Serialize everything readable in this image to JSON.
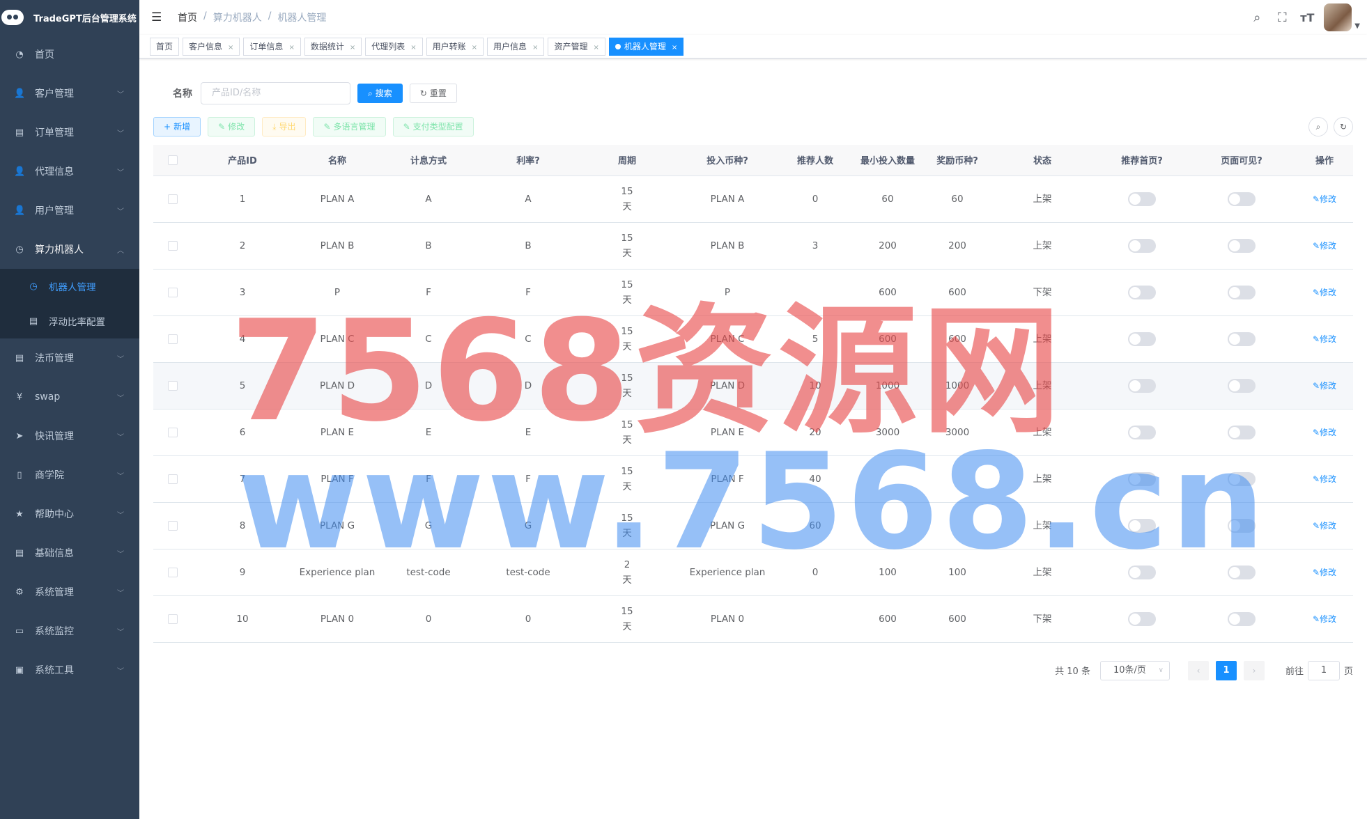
{
  "app": {
    "title": "TradeGPT后台管理系统"
  },
  "sidebar": {
    "items": [
      {
        "label": "首页",
        "icon": "dashboard-icon"
      },
      {
        "label": "客户管理",
        "icon": "user-icon"
      },
      {
        "label": "订单管理",
        "icon": "document-icon"
      },
      {
        "label": "代理信息",
        "icon": "user-icon"
      },
      {
        "label": "用户管理",
        "icon": "user-icon"
      },
      {
        "label": "算力机器人",
        "icon": "clock-icon"
      },
      {
        "label": "法币管理",
        "icon": "document-icon"
      },
      {
        "label": "swap",
        "icon": "yen-icon"
      },
      {
        "label": "快讯管理",
        "icon": "send-icon"
      },
      {
        "label": "商学院",
        "icon": "book-icon"
      },
      {
        "label": "帮助中心",
        "icon": "star-icon"
      },
      {
        "label": "基础信息",
        "icon": "document-icon"
      },
      {
        "label": "系统管理",
        "icon": "gear-icon"
      },
      {
        "label": "系统监控",
        "icon": "monitor-icon"
      },
      {
        "label": "系统工具",
        "icon": "toolbox-icon"
      }
    ],
    "sub": [
      {
        "label": "机器人管理",
        "icon": "clock-icon"
      },
      {
        "label": "浮动比率配置",
        "icon": "document-icon"
      }
    ]
  },
  "breadcrumb": [
    "首页",
    "/",
    "算力机器人",
    "/",
    "机器人管理"
  ],
  "tabs": [
    "首页",
    "客户信息",
    "订单信息",
    "数据统计",
    "代理列表",
    "用户转账",
    "用户信息",
    "资产管理",
    "机器人管理"
  ],
  "search": {
    "label": "名称",
    "placeholder": "产品ID/名称",
    "search_btn": "搜索",
    "reset_btn": "重置"
  },
  "toolbar": {
    "add": "新增",
    "edit": "修改",
    "export": "导出",
    "i18n": "多语言管理",
    "pay": "支付类型配置"
  },
  "table": {
    "headers": [
      "产品ID",
      "名称",
      "计息方式",
      "利率?",
      "周期",
      "投入币种?",
      "推荐人数",
      "最小投入数量",
      "奖励币种?",
      "状态",
      "推荐首页?",
      "页面可见?",
      "操作"
    ],
    "edit_label": "修改",
    "rows": [
      {
        "id": "1",
        "name": "PLAN A",
        "interest": "A",
        "rate": "A",
        "period": "15",
        "unit": "天",
        "coin": "PLAN A",
        "refs": "0",
        "min": "60",
        "reward": "60",
        "status": "上架",
        "recommend": false,
        "visible": false
      },
      {
        "id": "2",
        "name": "PLAN B",
        "interest": "B",
        "rate": "B",
        "period": "15",
        "unit": "天",
        "coin": "PLAN B",
        "refs": "3",
        "min": "200",
        "reward": "200",
        "status": "上架",
        "recommend": false,
        "visible": false
      },
      {
        "id": "3",
        "name": "P",
        "interest": "F",
        "rate": "F",
        "period": "15",
        "unit": "天",
        "coin": "P",
        "refs": "",
        "min": "600",
        "reward": "600",
        "status": "下架",
        "recommend": false,
        "visible": false
      },
      {
        "id": "4",
        "name": "PLAN C",
        "interest": "C",
        "rate": "C",
        "period": "15",
        "unit": "天",
        "coin": "PLAN C",
        "refs": "5",
        "min": "600",
        "reward": "600",
        "status": "上架",
        "recommend": false,
        "visible": false
      },
      {
        "id": "5",
        "name": "PLAN D",
        "interest": "D",
        "rate": "D",
        "period": "15",
        "unit": "天",
        "coin": "PLAN D",
        "refs": "10",
        "min": "1000",
        "reward": "1000",
        "status": "上架",
        "recommend": false,
        "visible": false
      },
      {
        "id": "6",
        "name": "PLAN E",
        "interest": "E",
        "rate": "E",
        "period": "15",
        "unit": "天",
        "coin": "PLAN E",
        "refs": "20",
        "min": "3000",
        "reward": "3000",
        "status": "上架",
        "recommend": false,
        "visible": false
      },
      {
        "id": "7",
        "name": "PLAN F",
        "interest": "F",
        "rate": "F",
        "period": "15",
        "unit": "天",
        "coin": "PLAN F",
        "refs": "40",
        "min": "",
        "reward": "",
        "status": "上架",
        "recommend": false,
        "visible": false
      },
      {
        "id": "8",
        "name": "PLAN G",
        "interest": "G",
        "rate": "G",
        "period": "15",
        "unit": "天",
        "coin": "PLAN G",
        "refs": "60",
        "min": "",
        "reward": "",
        "status": "上架",
        "recommend": false,
        "visible": false
      },
      {
        "id": "9",
        "name": "Experience plan",
        "interest": "test-code",
        "rate": "test-code",
        "period": "2",
        "unit": "天",
        "coin": "Experience plan",
        "refs": "0",
        "min": "100",
        "reward": "100",
        "status": "上架",
        "recommend": false,
        "visible": false
      },
      {
        "id": "10",
        "name": "PLAN 0",
        "interest": "0",
        "rate": "0",
        "period": "15",
        "unit": "天",
        "coin": "PLAN 0",
        "refs": "",
        "min": "600",
        "reward": "600",
        "status": "下架",
        "recommend": false,
        "visible": false
      }
    ]
  },
  "pager": {
    "total": "共 10 条",
    "size": "10条/页",
    "current": "1",
    "goto_prefix": "前往",
    "goto_value": "1",
    "goto_suffix": "页"
  },
  "watermark": {
    "line1": "7568资源网",
    "line2": "www.7568.cn"
  },
  "colors": {
    "sidebar": "#304156",
    "primary": "#1890ff"
  }
}
